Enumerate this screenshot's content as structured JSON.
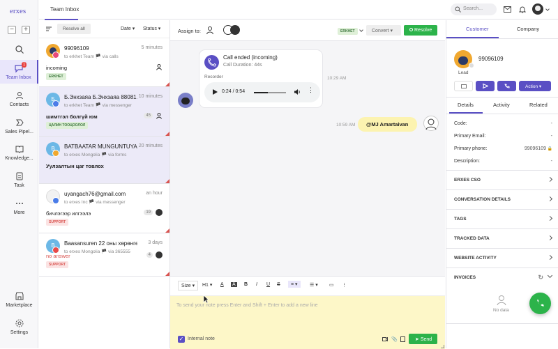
{
  "app": {
    "logo": "erxes"
  },
  "nav": {
    "zoom_out": "−",
    "zoom_in": "+",
    "items": [
      {
        "label": "",
        "icon": "search-icon"
      },
      {
        "label": "Team Inbox",
        "badge": "1",
        "icon": "chat-icon"
      },
      {
        "label": "Contacts",
        "icon": "contacts-icon"
      },
      {
        "label": "Sales Pipel...",
        "icon": "pipeline-icon"
      },
      {
        "label": "Knowledge...",
        "icon": "book-icon"
      },
      {
        "label": "Task",
        "icon": "task-icon"
      },
      {
        "label": "More",
        "icon": "more-icon"
      },
      {
        "label": "Marketplace",
        "icon": "store-icon"
      },
      {
        "label": "Settings",
        "icon": "gear-icon"
      }
    ]
  },
  "header": {
    "title": "Team Inbox",
    "search_placeholder": "Search..."
  },
  "list": {
    "resolve_all": "Resolve all",
    "date_filter": "Date",
    "status_filter": "Status",
    "conversations": [
      {
        "name": "99096109",
        "time": "5 minutes",
        "sub": "to erkhet Team 🏴 via calls",
        "message": "incoming",
        "tag": "ERKHET",
        "tag_bg": "#dff0d8",
        "tag_fg": "#3c763d",
        "avatar_color": "#f0a830",
        "count": ""
      },
      {
        "name": "Б.Энхзаяа Б.Энхзаяа 88081…",
        "time": "10 minutes",
        "sub": "to erkhet Team 🏴 via messenger",
        "message": "шимтгэл болгүй юм",
        "tag": "ЦАЛИН ТООЦООЛОЛ",
        "tag_bg": "#dff0d8",
        "tag_fg": "#3c763d",
        "avatar_color": "#6cb8e6",
        "count": "45",
        "initial": "Б"
      },
      {
        "name": "BATBAATAR MUNGUNTUYA …",
        "time": "20 minutes",
        "sub": "to erxes Mongolia 🏴 via forms",
        "message": "Уулзалтын цаг товлох",
        "tag": "",
        "avatar_color": "#6cb8e6",
        "count": "",
        "initial": "B"
      },
      {
        "name": "uyangach76@gmail.com",
        "time": "an hour",
        "sub": "to erxes Inc 🏴 via messenger",
        "message": "бичлэгээр илгээлэ",
        "tag": "SUPPORT",
        "tag_bg": "#fbe3e3",
        "tag_fg": "#d9534f",
        "avatar_color": "#f7f7f7",
        "count": "19"
      },
      {
        "name": "Baasansuren 22 оны хөрөнгө ор…",
        "time": "3 days",
        "sub": "to erxes Mongolia 🏴 via 365555",
        "message": "no answer",
        "tag": "SUPPORT",
        "tag_bg": "#fbe3e3",
        "tag_fg": "#d9534f",
        "avatar_color": "#6cb8e6",
        "count": "4",
        "initial": "B"
      }
    ]
  },
  "chat": {
    "assign_label": "Assign to:",
    "tag": "ERKHET",
    "convert": "Convert",
    "resolve": "Resolve",
    "call_title": "Call ended (incoming)",
    "call_duration": "Call Duration: 44s",
    "recorder_label": "Recorder",
    "audio_time": "0:24 / 0:54",
    "audio_progress": 0.44,
    "call_time": "10:29 AM",
    "mention": "@MJ Amartaivan",
    "mention_time": "10:59 AM"
  },
  "editor": {
    "size": "Size",
    "heading": "H1",
    "placeholder": "To send your note press Enter and Shift + Enter to add a new line",
    "internal_note": "Internal note",
    "send": "Send"
  },
  "right": {
    "tabs": [
      "Customer",
      "Company"
    ],
    "customer_name": "99096109",
    "customer_role": "Lead",
    "action": "Action",
    "sub_tabs": [
      "Details",
      "Activity",
      "Related"
    ],
    "fields": [
      {
        "label": "Code:",
        "value": "-"
      },
      {
        "label": "Primary Email:",
        "value": "-"
      },
      {
        "label": "Primary phone:",
        "value": "99096109"
      },
      {
        "label": "Description:",
        "value": "-"
      }
    ],
    "sections": [
      "ERXES CSO",
      "CONVERSATION DETAILS",
      "TAGS",
      "TRACKED DATA",
      "WEBSITE ACTIVITY",
      "INVOICES"
    ],
    "no_data": "No data"
  },
  "colors": {
    "accent": "#5a4fc4",
    "green": "#2cb34a",
    "note_bg": "#fdf7c8"
  }
}
